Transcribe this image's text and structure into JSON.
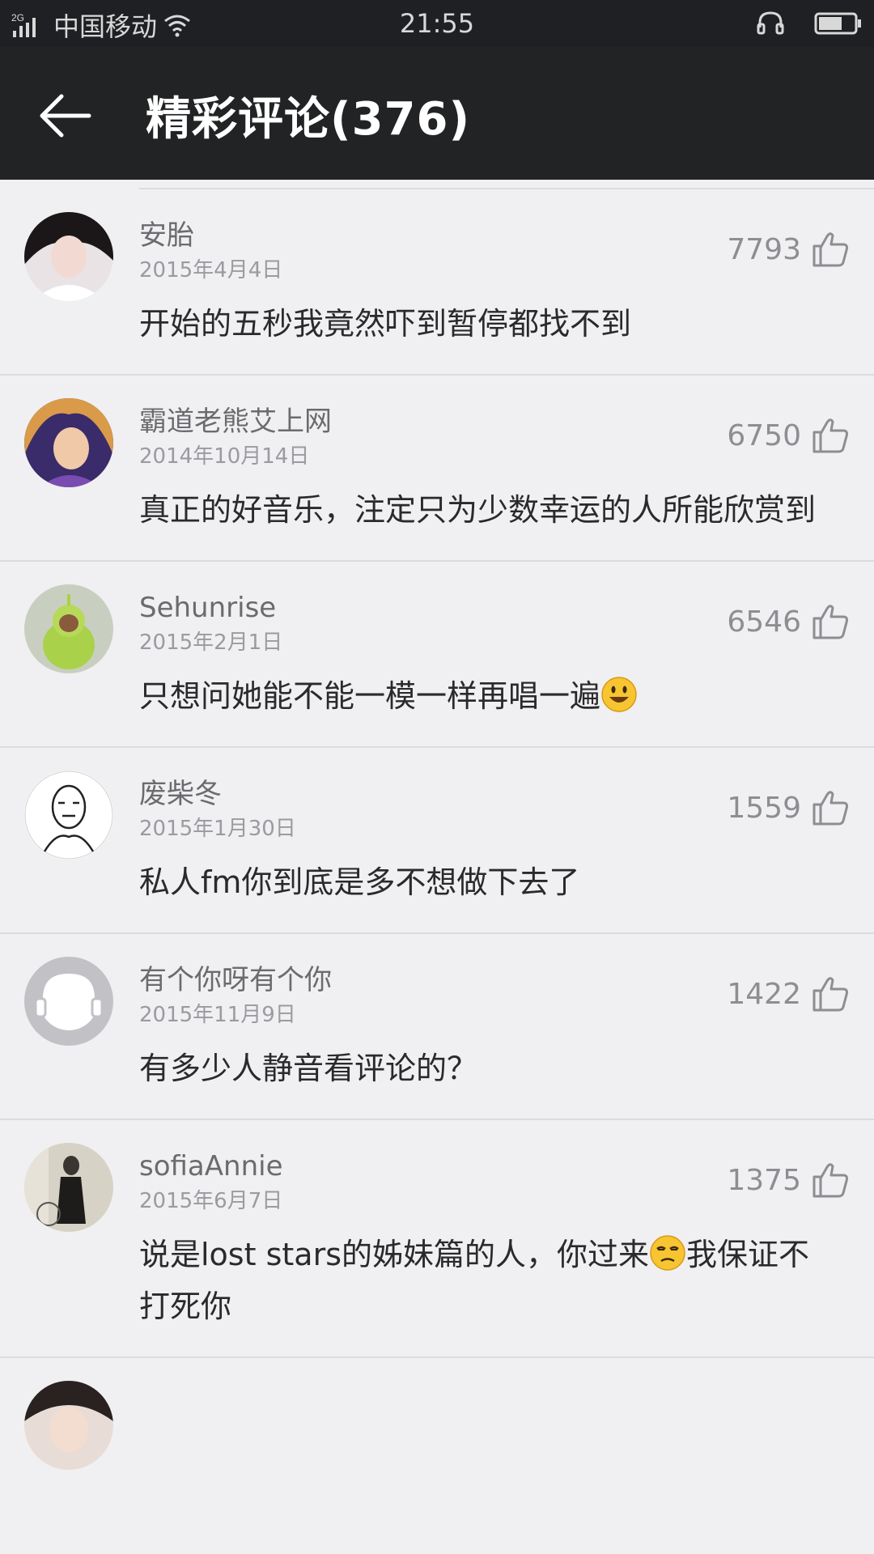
{
  "status_bar": {
    "network_label": "2G",
    "carrier": "中国移动",
    "time": "21:55"
  },
  "header": {
    "title": "精彩评论(376)"
  },
  "comments": [
    {
      "username": "安胎",
      "date": "2015年4月4日",
      "text": "开始的五秒我竟然吓到暂停都找不到",
      "likes": "7793",
      "emoji": ""
    },
    {
      "username": "霸道老熊艾上网",
      "date": "2014年10月14日",
      "text": "真正的好音乐，注定只为少数幸运的人所能欣赏到",
      "likes": "6750",
      "emoji": ""
    },
    {
      "username": "Sehunrise",
      "date": "2015年2月1日",
      "text": "只想问她能不能一模一样再唱一遍",
      "likes": "6546",
      "emoji": "smiley-emoji"
    },
    {
      "username": "废柴冬",
      "date": "2015年1月30日",
      "text": "私人fm你到底是多不想做下去了",
      "likes": "1559",
      "emoji": ""
    },
    {
      "username": "有个你呀有个你",
      "date": "2015年11月9日",
      "text": "有多少人静音看评论的？",
      "likes": "1422",
      "emoji": ""
    },
    {
      "username": "sofiaAnnie",
      "date": "2015年6月7日",
      "text_before": "说是lost stars的姊妹篇的人，你过来",
      "text_after": "我保证不打死你",
      "likes": "1375",
      "emoji": "unamused-emoji"
    }
  ],
  "colors": {
    "header_bg": "#222325",
    "page_bg": "#f0f0f2",
    "divider": "#dcdce0"
  }
}
